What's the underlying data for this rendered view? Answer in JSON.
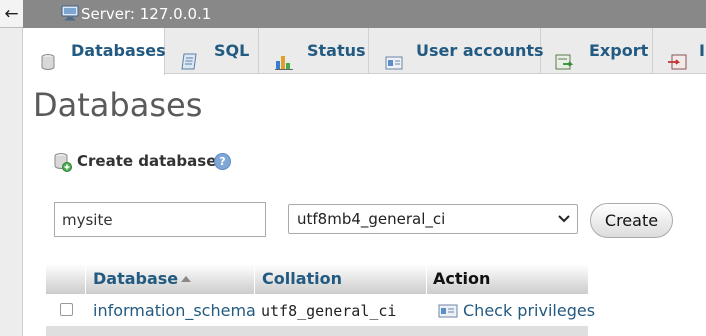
{
  "nav": {
    "back_glyph": "←"
  },
  "breadcrumb": {
    "server_label": "Server: 127.0.0.1",
    "icon": "server-icon"
  },
  "tabs": [
    {
      "label": "Databases",
      "icon": "database-icon",
      "active": true
    },
    {
      "label": "SQL",
      "icon": "sql-icon",
      "active": false
    },
    {
      "label": "Status",
      "icon": "status-icon",
      "active": false
    },
    {
      "label": "User accounts",
      "icon": "users-icon",
      "active": false
    },
    {
      "label": "Export",
      "icon": "export-icon",
      "active": false
    },
    {
      "label": "I",
      "icon": "import-icon",
      "active": false
    }
  ],
  "page": {
    "title": "Databases"
  },
  "create": {
    "heading": "Create database",
    "help_glyph": "?",
    "name_value": "mysite",
    "collation_value": "utf8mb4_general_ci",
    "button_label": "Create"
  },
  "table": {
    "headers": {
      "database": "Database",
      "collation": "Collation",
      "action": "Action"
    },
    "rows": [
      {
        "name": "information_schema",
        "collation": "utf8_general_ci",
        "action": "Check privileges"
      }
    ]
  },
  "colors": {
    "link": "#235a81",
    "topbar": "#888888",
    "tabbar": "#ebebeb"
  }
}
